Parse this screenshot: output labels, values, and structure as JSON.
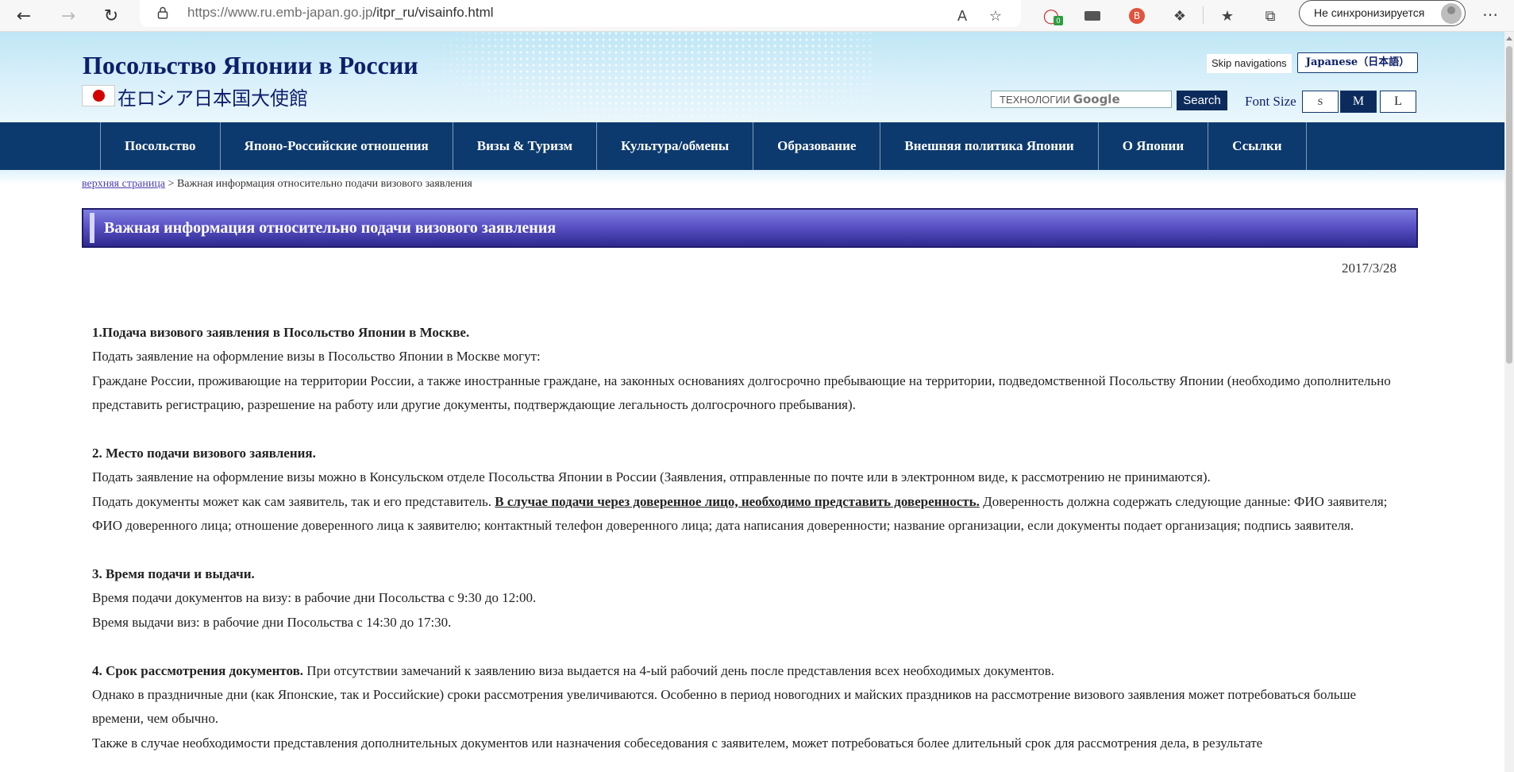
{
  "browser": {
    "url_host": "https://www.ru.emb-japan.go.jp",
    "url_path": "/itpr_ru/visainfo.html",
    "sync_label": "Не синхронизируется",
    "ext_badge": "0"
  },
  "header": {
    "title": "Посольство Японии в России",
    "subtitle": "在ロシア日本国大使館",
    "skip_label": "Skip navigations",
    "lang_label": "Japanese（日本語）",
    "search_placeholder": "ТЕХНОЛОГИИ",
    "search_google": "Google",
    "search_button": "Search",
    "font_size_label": "Font Size",
    "font_sizes": [
      "S",
      "M",
      "L"
    ]
  },
  "nav": {
    "items": [
      "Посольство",
      "Японо-Российские отношения",
      "Визы & Туризм",
      "Культура/обмены",
      "Образование",
      "Внешняя политика Японии",
      "О Японии",
      "Ссылки"
    ]
  },
  "breadcrumb": {
    "home": "верхняя страница",
    "separator": " > ",
    "current": "Важная информация относительно подачи визового заявления"
  },
  "page": {
    "heading": "Важная информация относительно подачи визового заявления",
    "date": "2017/3/28"
  },
  "article": {
    "s1_title": "1.Подача визового заявления в Посольство Японии в Москве.",
    "s1_l1": "Подать заявление на оформление визы в Посольство Японии в Москве могут:",
    "s1_l2": "Граждане России, проживающие на территории России, а также иностранные граждане, на законных основаниях долгосрочно пребывающие на территории, подведомственной Посольству Японии (необходимо дополнительно представить регистрацию, разрешение на работу или другие документы, подтверждающие легальность долгосрочного пребывания).",
    "s2_title": "2. Место подачи визового заявления.",
    "s2_l1": "Подать заявление на оформление визы можно в Консульском отделе Посольства Японии в России (Заявления, отправленные по почте или в электронном виде, к рассмотрению не принимаются).",
    "s2_l2a": "Подать документы может как сам заявитель, так и его представитель. ",
    "s2_l2b": "В случае подачи через доверенное лицо, необходимо представить доверенность.",
    "s2_l2c": " Доверенность должна содержать следующие данные: ФИО заявителя; ФИО доверенного лица; отношение доверенного лица к заявителю; контактный телефон доверенного лица; дата написания доверенности; название организации, если документы подает организация; подпись заявителя.",
    "s3_title": "3. Время подачи и выдачи.",
    "s3_l1": "Время подачи документов на визу: в рабочие дни Посольства с 9:30 до 12:00.",
    "s3_l2": "Время выдачи виз: в рабочие дни Посольства с 14:30 до 17:30.",
    "s4_title": "4. Срок рассмотрения документов.",
    "s4_l1": " При отсутствии замечаний к заявлению виза выдается на 4-ый рабочий день после представления всех необходимых документов.",
    "s4_l2": "Однако в праздничные дни (как Японские, так и Российские) сроки рассмотрения увеличиваются. Особенно в период новогодних и майских праздников на рассмотрение визового заявления может потребоваться больше времени, чем обычно.",
    "s4_l3": "Также в случае необходимости представления дополнительных документов или назначения собеседования с заявителем, может потребоваться более длительный срок для рассмотрения дела, в результате"
  }
}
